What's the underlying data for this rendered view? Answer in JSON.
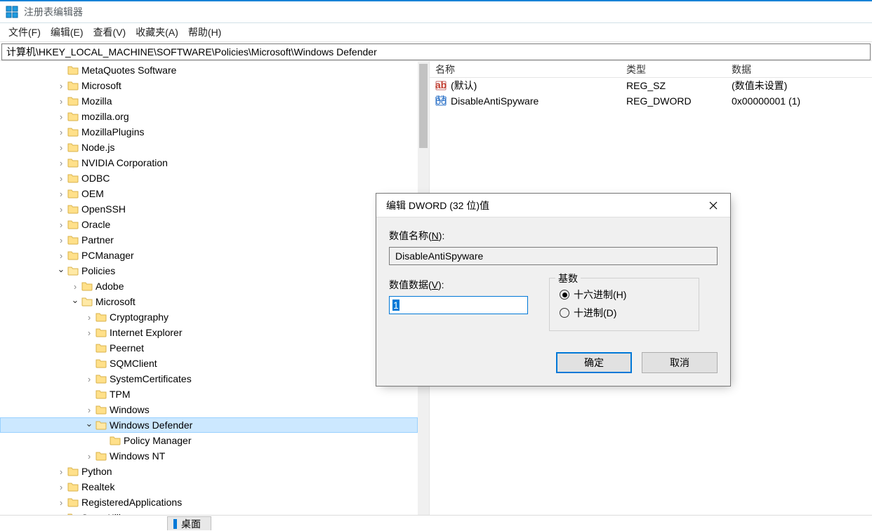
{
  "titlebar": {
    "title": "注册表编辑器"
  },
  "menubar": {
    "file": "文件(F)",
    "edit": "编辑(E)",
    "view": "查看(V)",
    "fav": "收藏夹(A)",
    "help": "帮助(H)"
  },
  "addressbar": "计算机\\HKEY_LOCAL_MACHINE\\SOFTWARE\\Policies\\Microsoft\\Windows Defender",
  "tree": [
    {
      "level": 0,
      "arrow": "",
      "label": "MetaQuotes Software"
    },
    {
      "level": 0,
      "arrow": ">",
      "label": "Microsoft"
    },
    {
      "level": 0,
      "arrow": ">",
      "label": "Mozilla"
    },
    {
      "level": 0,
      "arrow": ">",
      "label": "mozilla.org"
    },
    {
      "level": 0,
      "arrow": ">",
      "label": "MozillaPlugins"
    },
    {
      "level": 0,
      "arrow": ">",
      "label": "Node.js"
    },
    {
      "level": 0,
      "arrow": ">",
      "label": "NVIDIA Corporation"
    },
    {
      "level": 0,
      "arrow": ">",
      "label": "ODBC"
    },
    {
      "level": 0,
      "arrow": ">",
      "label": "OEM"
    },
    {
      "level": 0,
      "arrow": ">",
      "label": "OpenSSH"
    },
    {
      "level": 0,
      "arrow": ">",
      "label": "Oracle"
    },
    {
      "level": 0,
      "arrow": ">",
      "label": "Partner"
    },
    {
      "level": 0,
      "arrow": ">",
      "label": "PCManager"
    },
    {
      "level": 0,
      "arrow": "v",
      "label": "Policies"
    },
    {
      "level": 1,
      "arrow": ">",
      "label": "Adobe"
    },
    {
      "level": 1,
      "arrow": "v",
      "label": "Microsoft"
    },
    {
      "level": 2,
      "arrow": ">",
      "label": "Cryptography"
    },
    {
      "level": 2,
      "arrow": ">",
      "label": "Internet Explorer"
    },
    {
      "level": 2,
      "arrow": "",
      "label": "Peernet"
    },
    {
      "level": 2,
      "arrow": "",
      "label": "SQMClient"
    },
    {
      "level": 2,
      "arrow": ">",
      "label": "SystemCertificates"
    },
    {
      "level": 2,
      "arrow": "",
      "label": "TPM"
    },
    {
      "level": 2,
      "arrow": ">",
      "label": "Windows"
    },
    {
      "level": 2,
      "arrow": "v",
      "label": "Windows Defender",
      "selected": true
    },
    {
      "level": 3,
      "arrow": "",
      "label": "Policy Manager"
    },
    {
      "level": 2,
      "arrow": ">",
      "label": "Windows NT"
    },
    {
      "level": 0,
      "arrow": ">",
      "label": "Python"
    },
    {
      "level": 0,
      "arrow": ">",
      "label": "Realtek"
    },
    {
      "level": 0,
      "arrow": ">",
      "label": "RegisteredApplications"
    },
    {
      "level": 0,
      "arrow": ">",
      "label": "SuperKiller"
    }
  ],
  "values": {
    "headers": {
      "name": "名称",
      "type": "类型",
      "data": "数据"
    },
    "rows": [
      {
        "icon": "sz",
        "name": "(默认)",
        "type": "REG_SZ",
        "data": "(数值未设置)"
      },
      {
        "icon": "dword",
        "name": "DisableAntiSpyware",
        "type": "REG_DWORD",
        "data": "0x00000001 (1)"
      }
    ]
  },
  "dialog": {
    "title": "编辑 DWORD (32 位)值",
    "name_label_prefix": "数值名称(",
    "name_label_ul": "N",
    "name_label_suffix": "):",
    "name_value": "DisableAntiSpyware",
    "data_label_prefix": "数值数据(",
    "data_label_ul": "V",
    "data_label_suffix": "):",
    "data_value": "1",
    "radix_legend": "基数",
    "radix_hex_prefix": "十六进制(",
    "radix_hex_ul": "H",
    "radix_hex_suffix": ")",
    "radix_dec_prefix": "十进制(",
    "radix_dec_ul": "D",
    "radix_dec_suffix": ")",
    "ok": "确定",
    "cancel": "取消"
  },
  "taskbar": {
    "label": "桌面"
  }
}
